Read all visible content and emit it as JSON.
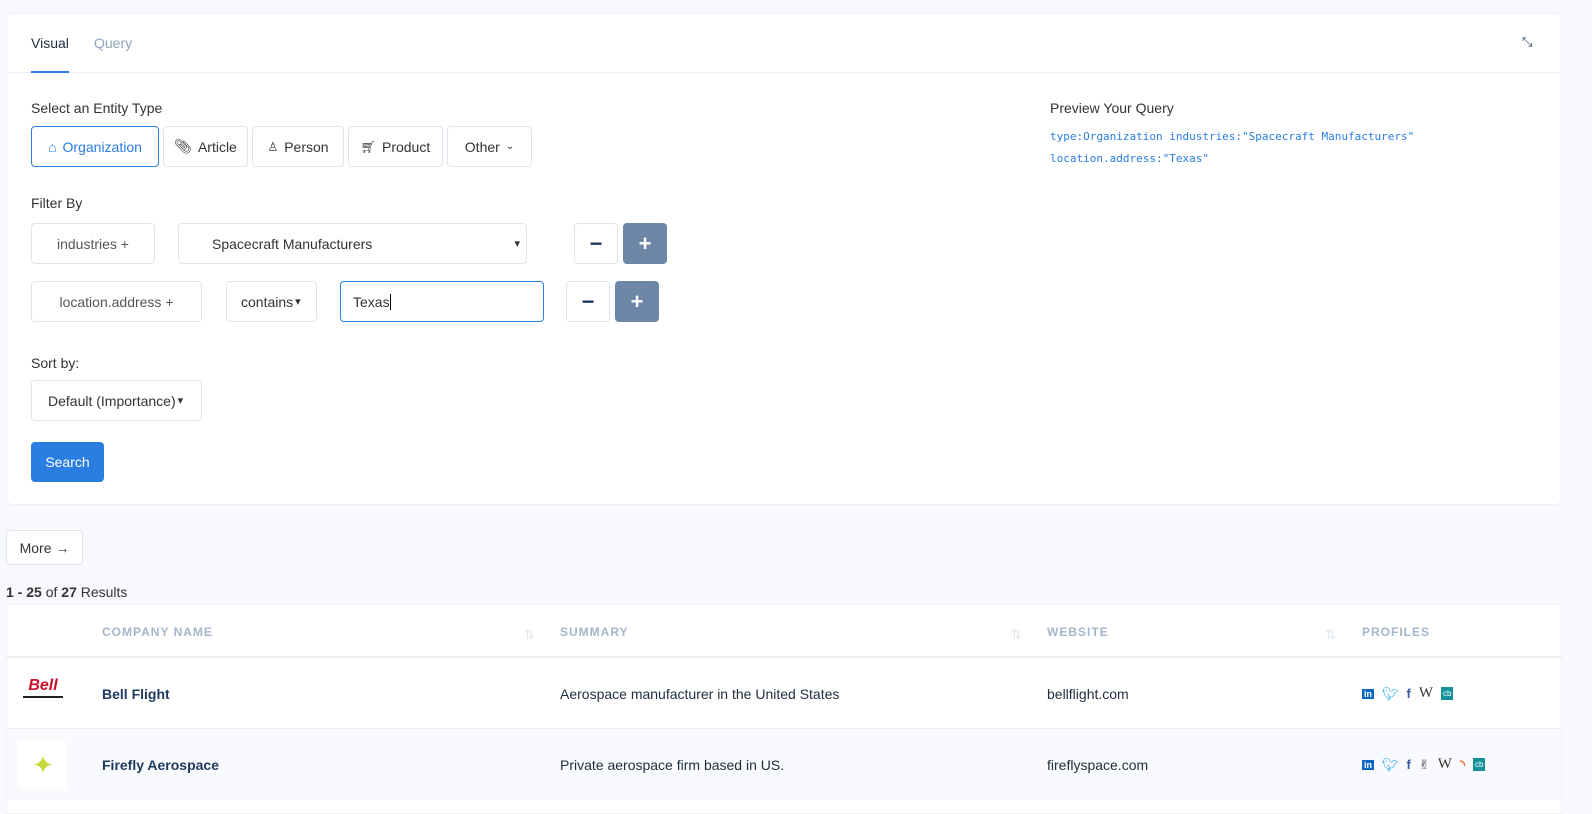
{
  "tabs": [
    {
      "label": "Visual",
      "active": true
    },
    {
      "label": "Query",
      "active": false
    }
  ],
  "collapse_icon": "collapse-arrows-icon",
  "entity": {
    "label": "Select an Entity Type",
    "types": [
      {
        "label": "Organization",
        "icon": "home-icon",
        "selected": true
      },
      {
        "label": "Article",
        "icon": "paperclip-icon"
      },
      {
        "label": "Person",
        "icon": "person-icon"
      },
      {
        "label": "Product",
        "icon": "cart-icon"
      },
      {
        "label": "Other",
        "icon": "chevron-down-icon"
      }
    ]
  },
  "filter": {
    "label": "Filter By",
    "rows": [
      {
        "field": "industries +",
        "value": "Spacecraft Manufacturers"
      },
      {
        "field": "location.address +",
        "operator": "contains",
        "value": "Texas"
      }
    ]
  },
  "sort": {
    "label": "Sort by:",
    "value": "Default (Importance)"
  },
  "search_label": "Search",
  "preview": {
    "title": "Preview Your Query",
    "lines": [
      "type:Organization industries:\"Spacecraft Manufacturers\"",
      "location.address:\"Texas\""
    ]
  },
  "more_label": "More →",
  "results": {
    "range": "1 - 25",
    "of": "of",
    "total": "27",
    "suffix": "Results"
  },
  "table": {
    "headers": [
      "COMPANY NAME",
      "SUMMARY",
      "WEBSITE",
      "PROFILES"
    ],
    "rows": [
      {
        "name": "Bell Flight",
        "logo": "Bell",
        "summary": "Aerospace manufacturer in the United States",
        "website": "bellflight.com",
        "profiles": [
          "linkedin",
          "twitter",
          "facebook",
          "wikipedia",
          "crunchbase"
        ]
      },
      {
        "name": "Firefly Aerospace",
        "logo": "",
        "summary": "Private aerospace firm based in US.",
        "website": "fireflyspace.com",
        "profiles": [
          "linkedin",
          "twitter",
          "facebook",
          "angellist",
          "wikipedia",
          "rss",
          "crunchbase"
        ]
      }
    ]
  },
  "colors": {
    "accent": "#2a7de1",
    "plus_button": "#6e87a6",
    "name": "#1f3a5f"
  }
}
